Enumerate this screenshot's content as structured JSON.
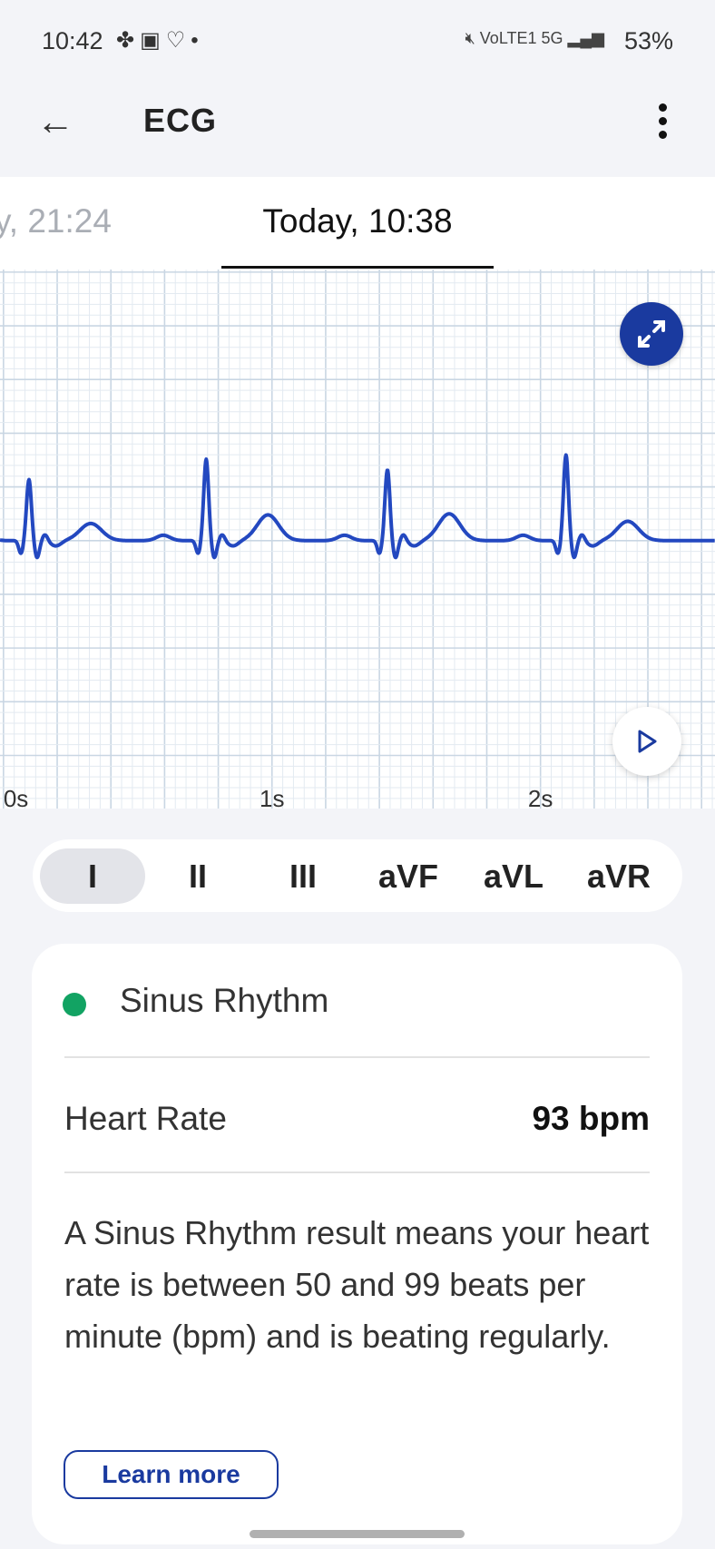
{
  "status_bar": {
    "time": "10:42",
    "left_icons": [
      "pinwheel-icon",
      "image-icon",
      "health-heart-icon",
      "dot-icon"
    ],
    "network": "VoLTE1 5G",
    "battery": "53%"
  },
  "header": {
    "title": "ECG"
  },
  "tabs": {
    "previous": "y, 21:24",
    "current": "Today, 10:38"
  },
  "chart_data": {
    "type": "line",
    "xlabel": "",
    "ylabel": "",
    "x_ticks": [
      "0s",
      "1s",
      "2s"
    ],
    "x_tick_values": [
      0,
      1,
      2
    ],
    "xlim": [
      -0.013,
      2.65
    ],
    "ylim_mV": [
      -2.5,
      2.53
    ],
    "grid": true,
    "line_color": "#2348c0",
    "beats": [
      {
        "r_time_s": 0.095,
        "r_mV": 0.57,
        "t_mV": 0.16
      },
      {
        "r_time_s": 0.755,
        "r_mV": 0.76,
        "t_mV": 0.24
      },
      {
        "r_time_s": 1.43,
        "r_mV": 0.66,
        "t_mV": 0.25
      },
      {
        "r_time_s": 2.095,
        "r_mV": 0.8,
        "t_mV": 0.18
      }
    ]
  },
  "leads": {
    "items": [
      "I",
      "II",
      "III",
      "aVF",
      "aVL",
      "aVR"
    ],
    "selected": "I"
  },
  "result": {
    "rhythm": "Sinus Rhythm",
    "rhythm_color": "#12a363",
    "heart_rate_label": "Heart Rate",
    "heart_rate_value": "93 bpm",
    "description": "A Sinus Rhythm result means your heart rate is between 50 and 99 beats per minute (bpm) and is beating regularly.",
    "learn_more": "Learn more"
  },
  "accent": "#1a3a9f"
}
